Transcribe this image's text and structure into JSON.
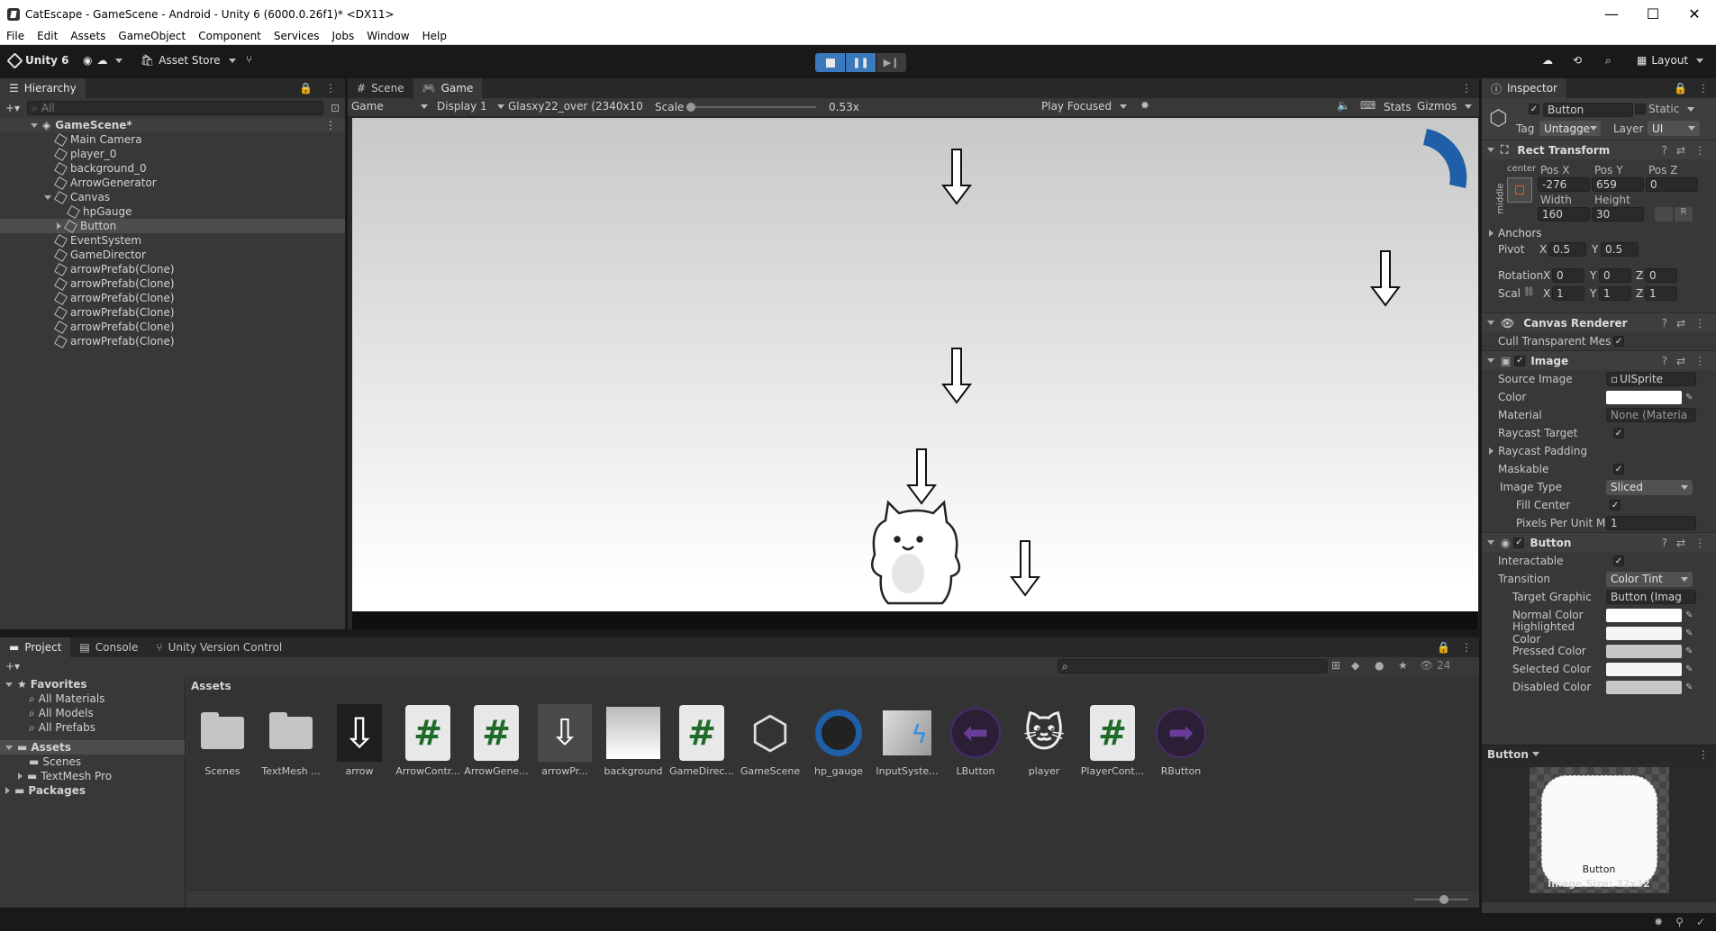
{
  "window": {
    "title": "CatEscape - GameScene - Android - Unity 6 (6000.0.26f1)* <DX11>"
  },
  "menu": [
    "File",
    "Edit",
    "Assets",
    "GameObject",
    "Component",
    "Services",
    "Jobs",
    "Window",
    "Help"
  ],
  "toolbar": {
    "unity_label": "Unity 6",
    "asset_store": "Asset Store",
    "layout": "Layout"
  },
  "hierarchy": {
    "tab": "Hierarchy",
    "search_placeholder": "All",
    "scene": "GameScene*",
    "items": [
      "Main Camera",
      "player_0",
      "background_0",
      "ArrowGenerator",
      "Canvas",
      "hpGauge",
      "Button",
      "EventSystem",
      "GameDirector",
      "arrowPrefab(Clone)",
      "arrowPrefab(Clone)",
      "arrowPrefab(Clone)",
      "arrowPrefab(Clone)",
      "arrowPrefab(Clone)",
      "arrowPrefab(Clone)"
    ]
  },
  "game_view": {
    "tabs": [
      "Scene",
      "Game"
    ],
    "mode": "Game",
    "display": "Display 1",
    "resolution": "Glasxy22_over (2340x10",
    "scale_label": "Scale",
    "scale_value": "0.53x",
    "play_focused": "Play Focused",
    "stats": "Stats",
    "gizmos": "Gizmos"
  },
  "inspector": {
    "tab": "Inspector",
    "object_name": "Button",
    "static_label": "Static",
    "tag_label": "Tag",
    "tag_value": "Untagge",
    "layer_label": "Layer",
    "layer_value": "UI",
    "rect_transform": {
      "title": "Rect Transform",
      "anchor_h": "center",
      "anchor_v": "middle",
      "posx_label": "Pos X",
      "posy_label": "Pos Y",
      "posz_label": "Pos Z",
      "posx": "-276",
      "posy": "659",
      "posz": "0",
      "width_label": "Width",
      "height_label": "Height",
      "width": "160",
      "height": "30",
      "anchors": "Anchors",
      "pivot_label": "Pivot",
      "pivot_x": "0.5",
      "pivot_y": "0.5",
      "rotation_label": "Rotation",
      "rot_x": "0",
      "rot_y": "0",
      "rot_z": "0",
      "scale_label": "Scal",
      "scale_x": "1",
      "scale_y": "1",
      "scale_z": "1",
      "x": "X",
      "y": "Y",
      "z": "Z",
      "r": "R"
    },
    "canvas_renderer": {
      "title": "Canvas Renderer",
      "cull": "Cull Transparent Mes"
    },
    "image": {
      "title": "Image",
      "source_image_label": "Source Image",
      "source_image": "UISprite",
      "color_label": "Color",
      "material_label": "Material",
      "material": "None (Materia",
      "raycast_target": "Raycast Target",
      "raycast_padding": "Raycast Padding",
      "maskable": "Maskable",
      "image_type_label": "Image Type",
      "image_type": "Sliced",
      "fill_center": "Fill Center",
      "ppu_label": "Pixels Per Unit Mu",
      "ppu": "1"
    },
    "button": {
      "title": "Button",
      "interactable": "Interactable",
      "transition_label": "Transition",
      "transition": "Color Tint",
      "target_graphic_label": "Target Graphic",
      "target_graphic": "Button (Imag",
      "normal": "Normal Color",
      "highlighted": "Highlighted Color",
      "pressed": "Pressed Color",
      "selected": "Selected Color",
      "disabled": "Disabled Color"
    },
    "preview": {
      "title": "Button",
      "label": "Button",
      "size": "Image Size: 32x32"
    }
  },
  "project": {
    "tabs": [
      "Project",
      "Console",
      "Unity Version Control"
    ],
    "favorites": "Favorites",
    "fav_items": [
      "All Materials",
      "All Models",
      "All Prefabs"
    ],
    "assets": "Assets",
    "asset_children": [
      "Scenes",
      "TextMesh Pro"
    ],
    "packages": "Packages",
    "breadcrumb": "Assets",
    "count": "24",
    "items": [
      "Scenes",
      "TextMesh ...",
      "arrow",
      "ArrowContr...",
      "ArrowGene...",
      "arrowPr...",
      "background",
      "GameDirec...",
      "GameScene",
      "hp_gauge",
      "InputSyste...",
      "LButton",
      "player",
      "PlayerCont...",
      "RButton"
    ]
  },
  "colors": {
    "accent": "#3a79bb",
    "script_green": "#1f6b2a",
    "gauge_blue": "#1f5fa8",
    "purple": "#4a2b6e"
  }
}
